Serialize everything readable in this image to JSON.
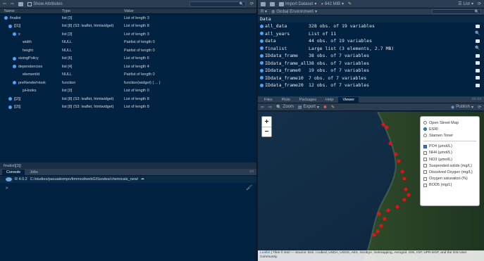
{
  "source_pane": {
    "toolbar": {
      "show_attributes_label": "Show Attributes",
      "search_placeholder": ""
    },
    "columns": {
      "name": "Name",
      "type": "Type",
      "value": "Value"
    },
    "rows": [
      {
        "name": "finalist",
        "type": "list [3]",
        "value": "List of length 3"
      },
      {
        "name": "[[1]]",
        "type": "list [8] (S3: leaflet, htmlwidget)",
        "value": "List of length 8"
      },
      {
        "name": "x",
        "type": "list [3]",
        "value": "List of length 3"
      },
      {
        "name": "width",
        "type": "NULL",
        "value": "Pairlist of length 0"
      },
      {
        "name": "height",
        "type": "NULL",
        "value": "Pairlist of length 0"
      },
      {
        "name": "sizingPolicy",
        "type": "list [6]",
        "value": "List of length 6"
      },
      {
        "name": "dependencies",
        "type": "list [4]",
        "value": "List of length 4"
      },
      {
        "name": "elementId",
        "type": "NULL",
        "value": "Pairlist of length 0"
      },
      {
        "name": "preRenderHook",
        "type": "function",
        "value": "function(widget) { ... }"
      },
      {
        "name": "jsHooks",
        "type": "list [0]",
        "value": "List of length 0"
      },
      {
        "name": "[[2]]",
        "type": "list [8] (S3: leaflet, htmlwidget)",
        "value": "List of length 8"
      },
      {
        "name": "[[3]]",
        "type": "list [8] (S3: leaflet, htmlwidget)",
        "value": "List of length 8"
      }
    ],
    "status": "finalist[[3]]"
  },
  "console_pane": {
    "tabs": [
      {
        "label": "Console"
      },
      {
        "label": "Jobs"
      }
    ],
    "r_version": "R 4.0.2",
    "path": "C:/studies/pasuaitompo/timmod/webGISsodes/chemicals_new/",
    "prompt": ">"
  },
  "env_pane": {
    "toolbar": {
      "import_label": "Import Dataset",
      "memory_label": "642 MiB",
      "list_label": "List",
      "global_env_label": "Global Environment"
    },
    "section_title": "Data",
    "items": [
      {
        "name": "all_data",
        "value": "328 obs. of 19 variables",
        "icon": "table"
      },
      {
        "name": "all_years",
        "value": "List of  11",
        "icon": "search"
      },
      {
        "name": "data",
        "value": "44 obs. of 19 variables",
        "icon": "table"
      },
      {
        "name": "finalist",
        "value": "Large list (3 elements,  2.7 MB)",
        "icon": "search"
      },
      {
        "name": "IDdata_frame",
        "value": "38 obs. of 7 variables",
        "icon": "table"
      },
      {
        "name": "IDdata_frame_all",
        "value": "38 obs. of 7 variables",
        "icon": "table"
      },
      {
        "name": "IDdata_frame0",
        "value": "19 obs. of 7 variables",
        "icon": "table"
      },
      {
        "name": "IDdata_frame10",
        "value": "7 obs. of 7 variables",
        "icon": "table"
      },
      {
        "name": "IDdata_frame20",
        "value": "12 obs. of 7 variables",
        "icon": "table"
      }
    ]
  },
  "viewer_pane": {
    "tabs": [
      {
        "label": "Files"
      },
      {
        "label": "Plots"
      },
      {
        "label": "Packages"
      },
      {
        "label": "Help"
      },
      {
        "label": "Viewer"
      }
    ],
    "toolbar": {
      "zoom_label": "Zoom",
      "export_label": "Export",
      "publish_label": "Publish"
    },
    "zoom_in": "+",
    "zoom_out": "−",
    "base_layers": [
      {
        "label": "Open Street Map",
        "selected": 0
      },
      {
        "label": "ESRI",
        "selected": 1
      },
      {
        "label": "Stamen Toner",
        "selected": 0
      }
    ],
    "overlays": [
      {
        "label": "PO4 (µmol/L)",
        "checked": 1
      },
      {
        "label": "NH4 (µmol/L)",
        "checked": 0
      },
      {
        "label": "NO3 (µmol/L)",
        "checked": 0
      },
      {
        "label": "Suspended solids (mg/L)",
        "checked": 0
      },
      {
        "label": "Dissolved Oxygen (mg/L)",
        "checked": 0
      },
      {
        "label": "Oxygen saturation (%)",
        "checked": 0
      },
      {
        "label": "BOD5 (mg/L)",
        "checked": 0
      }
    ],
    "attribution_link": "Leaflet",
    "attribution_text": " | Tiles © Esri — Source: Esri, i-cubed, USDA, USGS, AEX, GeoEye, Getmapping, Aerogrid, IGN, IGP, UPR-EGP, and the GIS User Community",
    "marker_color": "#ee1111",
    "accent_color": "#4fa3f7"
  }
}
